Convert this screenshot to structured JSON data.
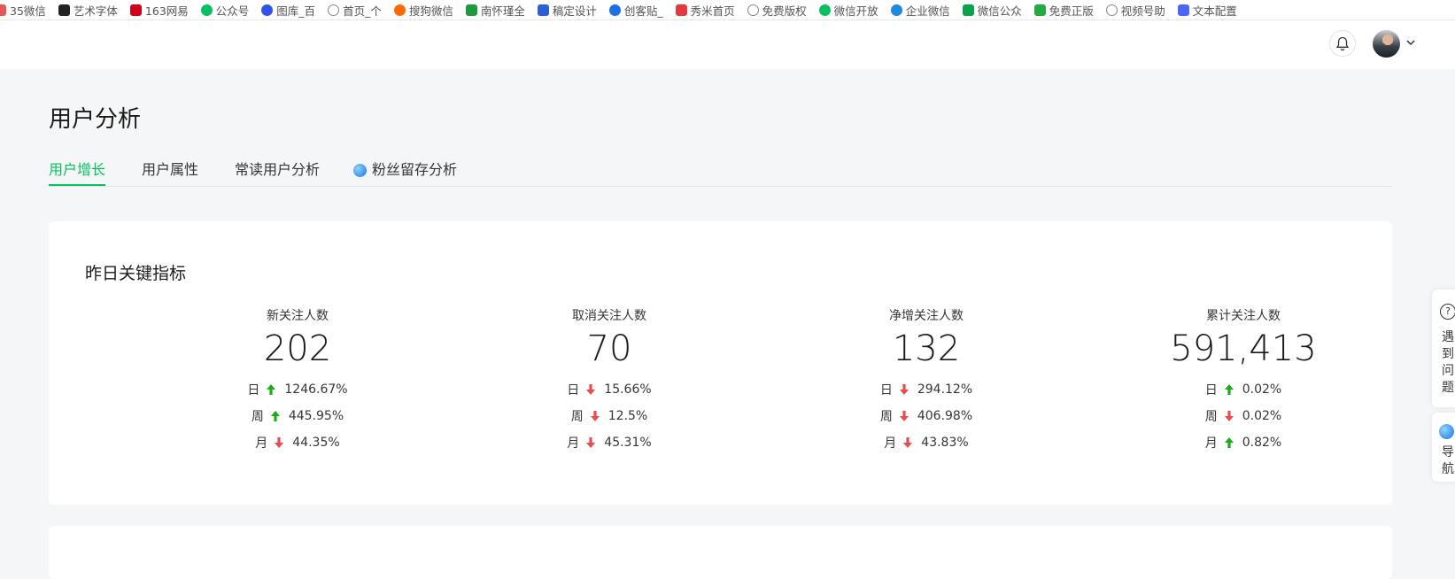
{
  "bookmarks": [
    {
      "label": "35微信",
      "color": "#e65757",
      "icon": "bookmark-35wx-icon"
    },
    {
      "label": "艺术字体",
      "color": "#222222",
      "icon": "bookmark-art-icon"
    },
    {
      "label": "163网易",
      "color": "#d0021b",
      "icon": "bookmark-163-icon"
    },
    {
      "label": "公众号",
      "color": "#07c160",
      "icon": "bookmark-gzh-icon"
    },
    {
      "label": "图库_百",
      "color": "#2f54eb",
      "icon": "bookmark-baidu-icon"
    },
    {
      "label": "首页_个",
      "color": "#888888",
      "icon": "globe-icon"
    },
    {
      "label": "搜狗微信",
      "color": "#ff6a00",
      "icon": "bookmark-sogou-icon"
    },
    {
      "label": "南怀瑾全",
      "color": "#1d9a3f",
      "icon": "bookmark-nhj-icon"
    },
    {
      "label": "稿定设计",
      "color": "#2b5fd9",
      "icon": "bookmark-gaoding-icon"
    },
    {
      "label": "创客贴_",
      "color": "#1e6fe6",
      "icon": "bookmark-ckt-icon"
    },
    {
      "label": "秀米首页",
      "color": "#e6393f",
      "icon": "bookmark-xiumi-icon"
    },
    {
      "label": "免费版权",
      "color": "#888888",
      "icon": "globe-icon"
    },
    {
      "label": "微信开放",
      "color": "#07c160",
      "icon": "bookmark-wechat-icon"
    },
    {
      "label": "企业微信",
      "color": "#1e88e5",
      "icon": "bookmark-wework-icon"
    },
    {
      "label": "微信公众",
      "color": "#09a34b",
      "icon": "bookmark-96-icon"
    },
    {
      "label": "免费正版",
      "color": "#25a942",
      "icon": "bookmark-px-icon"
    },
    {
      "label": "视频号助",
      "color": "#888888",
      "icon": "globe-icon"
    },
    {
      "label": "文本配置",
      "color": "#4a67f5",
      "icon": "bookmark-text-icon"
    }
  ],
  "page_title": "用户分析",
  "tabs": [
    {
      "label": "用户增长",
      "active": true
    },
    {
      "label": "用户属性",
      "active": false
    },
    {
      "label": "常读用户分析",
      "active": false
    },
    {
      "label": "粉丝留存分析",
      "active": false
    }
  ],
  "card": {
    "title": "昨日关键指标",
    "metrics": [
      {
        "label": "新关注人数",
        "value": "202",
        "rows": [
          {
            "period": "日",
            "dir": "up",
            "pct": "1246.67%"
          },
          {
            "period": "周",
            "dir": "up",
            "pct": "445.95%"
          },
          {
            "period": "月",
            "dir": "down",
            "pct": "44.35%"
          }
        ]
      },
      {
        "label": "取消关注人数",
        "value": "70",
        "rows": [
          {
            "period": "日",
            "dir": "down",
            "pct": "15.66%"
          },
          {
            "period": "周",
            "dir": "down",
            "pct": "12.5%"
          },
          {
            "period": "月",
            "dir": "down",
            "pct": "45.31%"
          }
        ]
      },
      {
        "label": "净增关注人数",
        "value": "132",
        "rows": [
          {
            "period": "日",
            "dir": "down",
            "pct": "294.12%"
          },
          {
            "period": "周",
            "dir": "down",
            "pct": "406.98%"
          },
          {
            "period": "月",
            "dir": "down",
            "pct": "43.83%"
          }
        ]
      },
      {
        "label": "累计关注人数",
        "value": "591,413",
        "rows": [
          {
            "period": "日",
            "dir": "up",
            "pct": "0.02%"
          },
          {
            "period": "周",
            "dir": "down",
            "pct": "0.02%"
          },
          {
            "period": "月",
            "dir": "up",
            "pct": "0.82%"
          }
        ]
      }
    ]
  },
  "side": {
    "help_q": "?",
    "help_text": [
      "遇",
      "到",
      "问",
      "题"
    ],
    "nav_text": [
      "导",
      "航"
    ]
  },
  "colors": {
    "accent": "#07c160",
    "up": "#1aad19",
    "down": "#e84d4d"
  }
}
